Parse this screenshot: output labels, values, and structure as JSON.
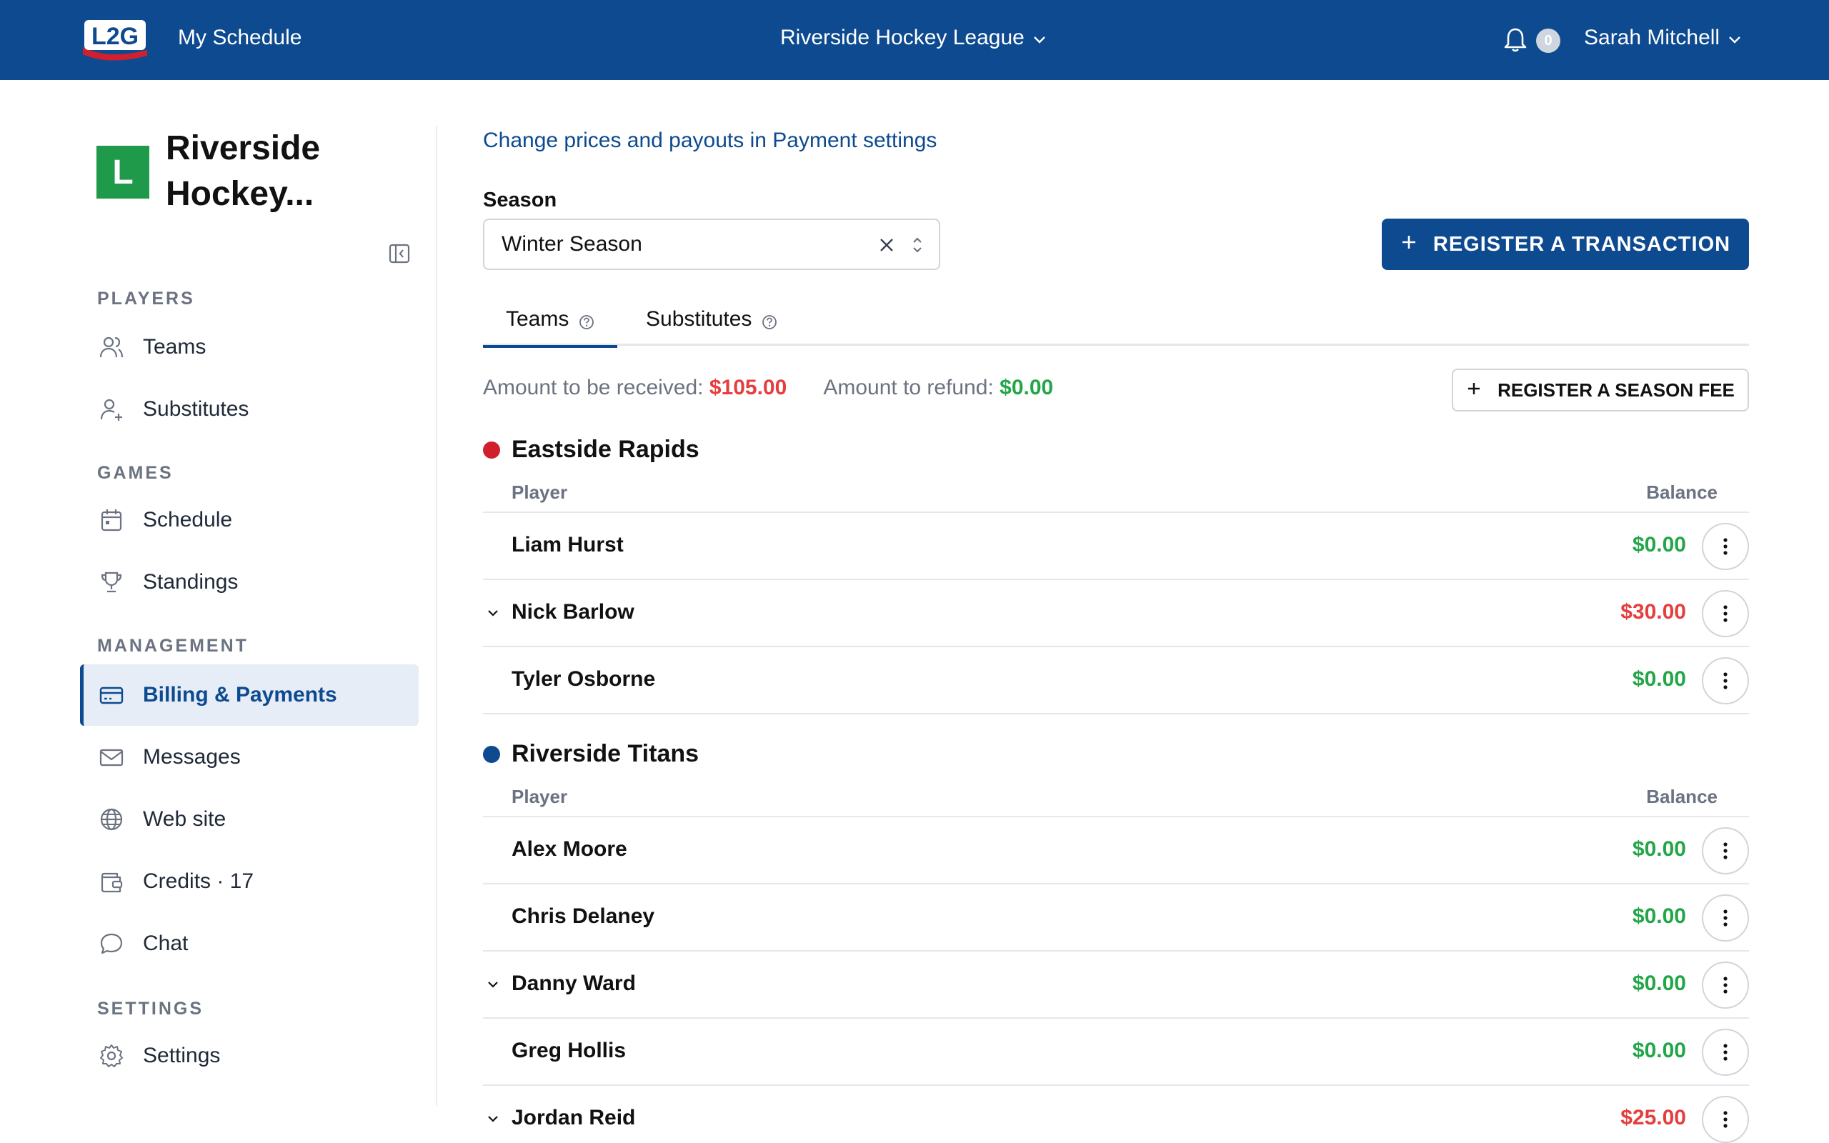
{
  "topbar": {
    "logo_text": "L2G",
    "my_schedule": "My Schedule",
    "league": "Riverside Hockey League",
    "notification_count": "0",
    "user_name": "Sarah Mitchell"
  },
  "sidebar": {
    "org_logo_letter": "L",
    "org_name": "Riverside Hockey...",
    "sections": {
      "players": "PLAYERS",
      "games": "GAMES",
      "management": "MANAGEMENT",
      "settings": "SETTINGS"
    },
    "items": {
      "teams": "Teams",
      "substitutes": "Substitutes",
      "schedule": "Schedule",
      "standings": "Standings",
      "billing": "Billing & Payments",
      "messages": "Messages",
      "website": "Web site",
      "credits": "Credits · 17",
      "chat": "Chat",
      "settings": "Settings"
    }
  },
  "main": {
    "settings_link": "Change prices and payouts in Payment settings",
    "season_label": "Season",
    "season_value": "Winter Season",
    "register_transaction": "REGISTER A TRANSACTION",
    "tabs": {
      "teams": "Teams",
      "substitutes": "Substitutes"
    },
    "amount_received_label": "Amount to be received:",
    "amount_received": "$105.00",
    "amount_refund_label": "Amount to refund:",
    "amount_refund": "$0.00",
    "register_fee": "REGISTER A SEASON FEE",
    "col_player": "Player",
    "col_balance": "Balance",
    "teams": [
      {
        "name": "Eastside Rapids",
        "color": "#d0202e",
        "players": [
          {
            "name": "Liam Hurst",
            "balance": "$0.00"
          },
          {
            "name": "Nick Barlow",
            "balance": "$30.00"
          },
          {
            "name": "Tyler Osborne",
            "balance": "$0.00"
          }
        ]
      },
      {
        "name": "Riverside Titans",
        "color": "#0d4a8f",
        "players": [
          {
            "name": "Alex Moore",
            "balance": "$0.00"
          },
          {
            "name": "Chris Delaney",
            "balance": "$0.00"
          },
          {
            "name": "Danny Ward",
            "balance": "$0.00"
          },
          {
            "name": "Greg Hollis",
            "balance": "$0.00"
          },
          {
            "name": "Jordan Reid",
            "balance": "$25.00"
          }
        ]
      }
    ]
  },
  "colors": {
    "brand": "#0d4a8f",
    "positive": "#22a648",
    "negative": "#e53e3e"
  }
}
